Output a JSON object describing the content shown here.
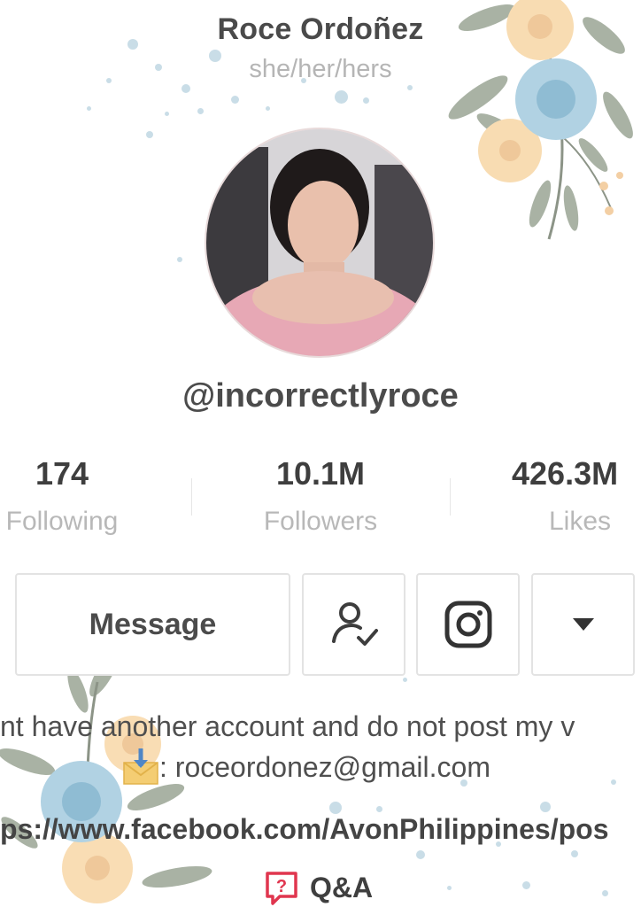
{
  "profile": {
    "display_name": "Roce Ordoñez",
    "pronouns": "she/her/hers",
    "username": "@incorrectlyroce"
  },
  "stats": {
    "following": {
      "value": "174",
      "label": "Following"
    },
    "followers": {
      "value": "10.1M",
      "label": "Followers"
    },
    "likes": {
      "value": "426.3M",
      "label": "Likes"
    }
  },
  "actions": {
    "message_label": "Message",
    "following_icon": "person-check-icon",
    "instagram_icon": "instagram-icon",
    "more_icon": "caret-down-icon"
  },
  "bio": {
    "line1": "nt have another account and do not post my v",
    "line2": ": roceordonez@gmail.com",
    "line3": "ps://www.facebook.com/AvonPhilippines/pos",
    "line2_icon": "envelope-download-icon"
  },
  "qa": {
    "label": "Q&A",
    "icon": "question-bubble-icon",
    "accent": "#e0364f"
  },
  "colors": {
    "flower_peach": "#f8d9ae",
    "flower_blue": "#9cc6dc",
    "leaf": "#8c9487"
  }
}
